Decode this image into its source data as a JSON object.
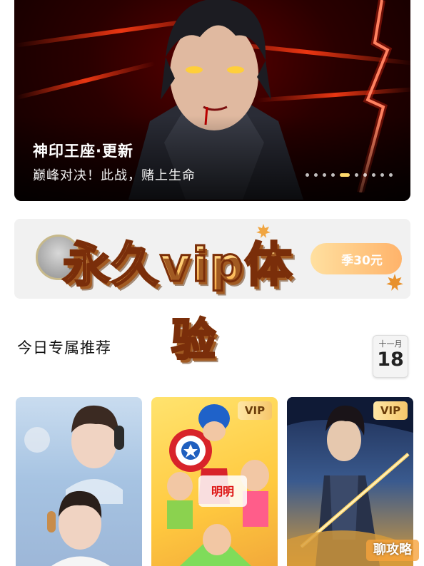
{
  "banner": {
    "title": "神印王座·更新",
    "subtitle": "巅峰对决！此战，赌上生命",
    "carousel_total": 10,
    "carousel_active_index": 4
  },
  "vip_strip": {
    "pill_text": "季30元"
  },
  "overlay": {
    "line1": "永久vip体",
    "line2": "验"
  },
  "section": {
    "title": "今日专属推荐"
  },
  "calendar": {
    "month": "十一月",
    "day": "18"
  },
  "cards": [
    {
      "name": "romance-drama",
      "badge": ""
    },
    {
      "name": "kids-show",
      "badge": "VIP"
    },
    {
      "name": "anime-series",
      "badge": "VIP"
    }
  ],
  "watermark": {
    "text": "聊攻略"
  },
  "colors": {
    "accent_gold": "#f6c66a",
    "banner_red": "#c40000",
    "text_dark": "#111111"
  }
}
